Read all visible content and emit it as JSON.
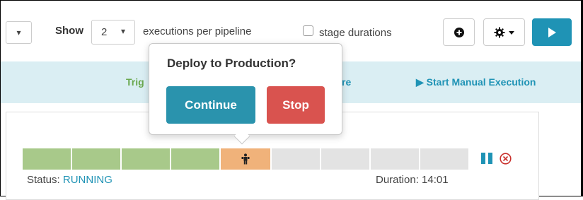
{
  "toolbar": {
    "partial_select_caret": "▾",
    "show_label": "Show",
    "executions_value": "2",
    "executions_caret": "▾",
    "per_pipeline_label": "executions per pipeline",
    "stage_durations_label": "stage durations",
    "stage_durations_checked": false,
    "icons": {
      "plus": "plus-circle-icon",
      "gear": "gear-icon",
      "gear_caret": "chevron-down-icon",
      "play": "play-icon"
    }
  },
  "band": {
    "trigger_partial": "Trig",
    "partial_right": "re",
    "manual_execution_label": "▶ Start Manual Execution"
  },
  "popover": {
    "title": "Deploy to Production?",
    "continue_label": "Continue",
    "stop_label": "Stop"
  },
  "execution": {
    "status_prefix": "Status: ",
    "status_value": "RUNNING",
    "duration_prefix": "Duration: ",
    "duration_value": "14:01",
    "stages": [
      {
        "state": "succeeded"
      },
      {
        "state": "succeeded"
      },
      {
        "state": "succeeded"
      },
      {
        "state": "succeeded"
      },
      {
        "state": "waiting",
        "icon": "manual-judgment-icon"
      },
      {
        "state": "not-started"
      },
      {
        "state": "not-started"
      },
      {
        "state": "not-started"
      },
      {
        "state": "not-started"
      }
    ]
  },
  "colors": {
    "accent": "#1f93b5",
    "succeeded": "#a8c98a",
    "waiting": "#f0b27a",
    "not_started": "#e3e3e3",
    "stop": "#d9534f",
    "cancel": "#c9302c",
    "band": "#daeef3"
  }
}
